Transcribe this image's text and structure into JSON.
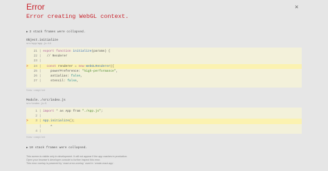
{
  "header": {
    "title": "Error",
    "close": "×"
  },
  "error": {
    "message": "Error creating WebGL context."
  },
  "collapsed_top": "3 stack frames were collapsed.",
  "collapsed_bottom": "10 stack frames were collapsed.",
  "frames": [
    {
      "name": "Object.initialize",
      "file": "src/app/app.js:14",
      "toggle": "View compiled",
      "lines": [
        {
          "no": "21",
          "marker": "",
          "parts": [
            [
              "kw",
              "export "
            ],
            [
              "kw",
              "function "
            ],
            [
              "fn",
              "initialize"
            ],
            [
              "",
              "(params) {"
            ]
          ]
        },
        {
          "no": "22",
          "marker": "",
          "parts": [
            [
              "",
              "  // Renderer"
            ]
          ]
        },
        {
          "no": "23",
          "marker": "",
          "parts": [
            [
              "",
              ""
            ]
          ]
        },
        {
          "no": "24",
          "marker": ">",
          "parts": [
            [
              "kw",
              "  const "
            ],
            [
              "",
              "renderer = "
            ],
            [
              "kw",
              "new "
            ],
            [
              "fn",
              "WebGLRenderer"
            ],
            [
              "",
              "({"
            ]
          ]
        },
        {
          "no": "25",
          "marker": "",
          "parts": [
            [
              "",
              "    powerPreference: "
            ],
            [
              "str",
              "\"high-performance\""
            ],
            [
              "",
              ","
            ]
          ]
        },
        {
          "no": "26",
          "marker": "",
          "parts": [
            [
              "",
              "    antialias: "
            ],
            [
              "num",
              "false"
            ],
            [
              "",
              ","
            ]
          ]
        },
        {
          "no": "27",
          "marker": "",
          "parts": [
            [
              "",
              "    stencil: "
            ],
            [
              "num",
              "false"
            ],
            [
              "",
              ","
            ]
          ]
        }
      ]
    },
    {
      "name": "Module../src/index.js",
      "file": "src/index.js:5",
      "toggle": "View compiled",
      "lines": [
        {
          "no": "1",
          "marker": "",
          "parts": [
            [
              "kw",
              "import "
            ],
            [
              "",
              "* as App from "
            ],
            [
              "str",
              "\"./App.js\""
            ],
            [
              "",
              ";"
            ]
          ]
        },
        {
          "no": "2",
          "marker": "",
          "parts": [
            [
              "",
              ""
            ]
          ]
        },
        {
          "no": "3",
          "marker": ">",
          "parts": [
            [
              "fn",
              "App.initialize"
            ],
            [
              "",
              "();"
            ]
          ]
        },
        {
          "no": "",
          "marker": "",
          "parts": [
            [
              "",
              "    ^"
            ]
          ]
        },
        {
          "no": "4",
          "marker": "",
          "parts": [
            [
              "",
              ""
            ]
          ]
        }
      ]
    }
  ],
  "footer": {
    "line1": "This screen is visible only in development. It will not appear if the app crashes in production.",
    "line2": "Open your browser’s developer console to further inspect this error.",
    "line3": "This error overlay is powered by `react-error-overlay` used in `create-react-app`."
  }
}
